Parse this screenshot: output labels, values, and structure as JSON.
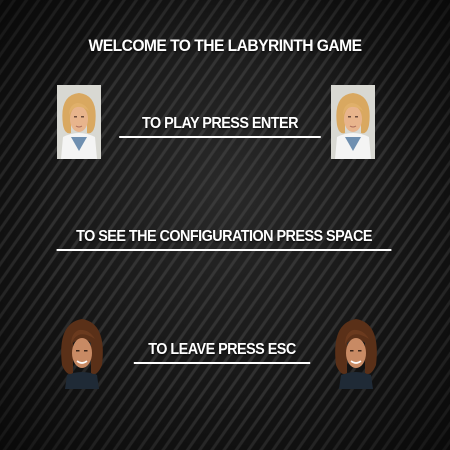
{
  "title": "WELCOME TO THE LABYRINTH GAME",
  "menu": {
    "play": "TO PLAY PRESS ENTER",
    "config": "TO SEE THE CONFIGURATION PRESS SPACE",
    "leave": "TO LEAVE PRESS ESC"
  },
  "colors": {
    "text": "#ffffff",
    "background": "#1c1c1c",
    "stripe": "#2e2e2e"
  },
  "icons": {
    "top_portraits": "blonde-character-portrait-icon",
    "bottom_portraits": "brown-haired-character-portrait-icon"
  }
}
